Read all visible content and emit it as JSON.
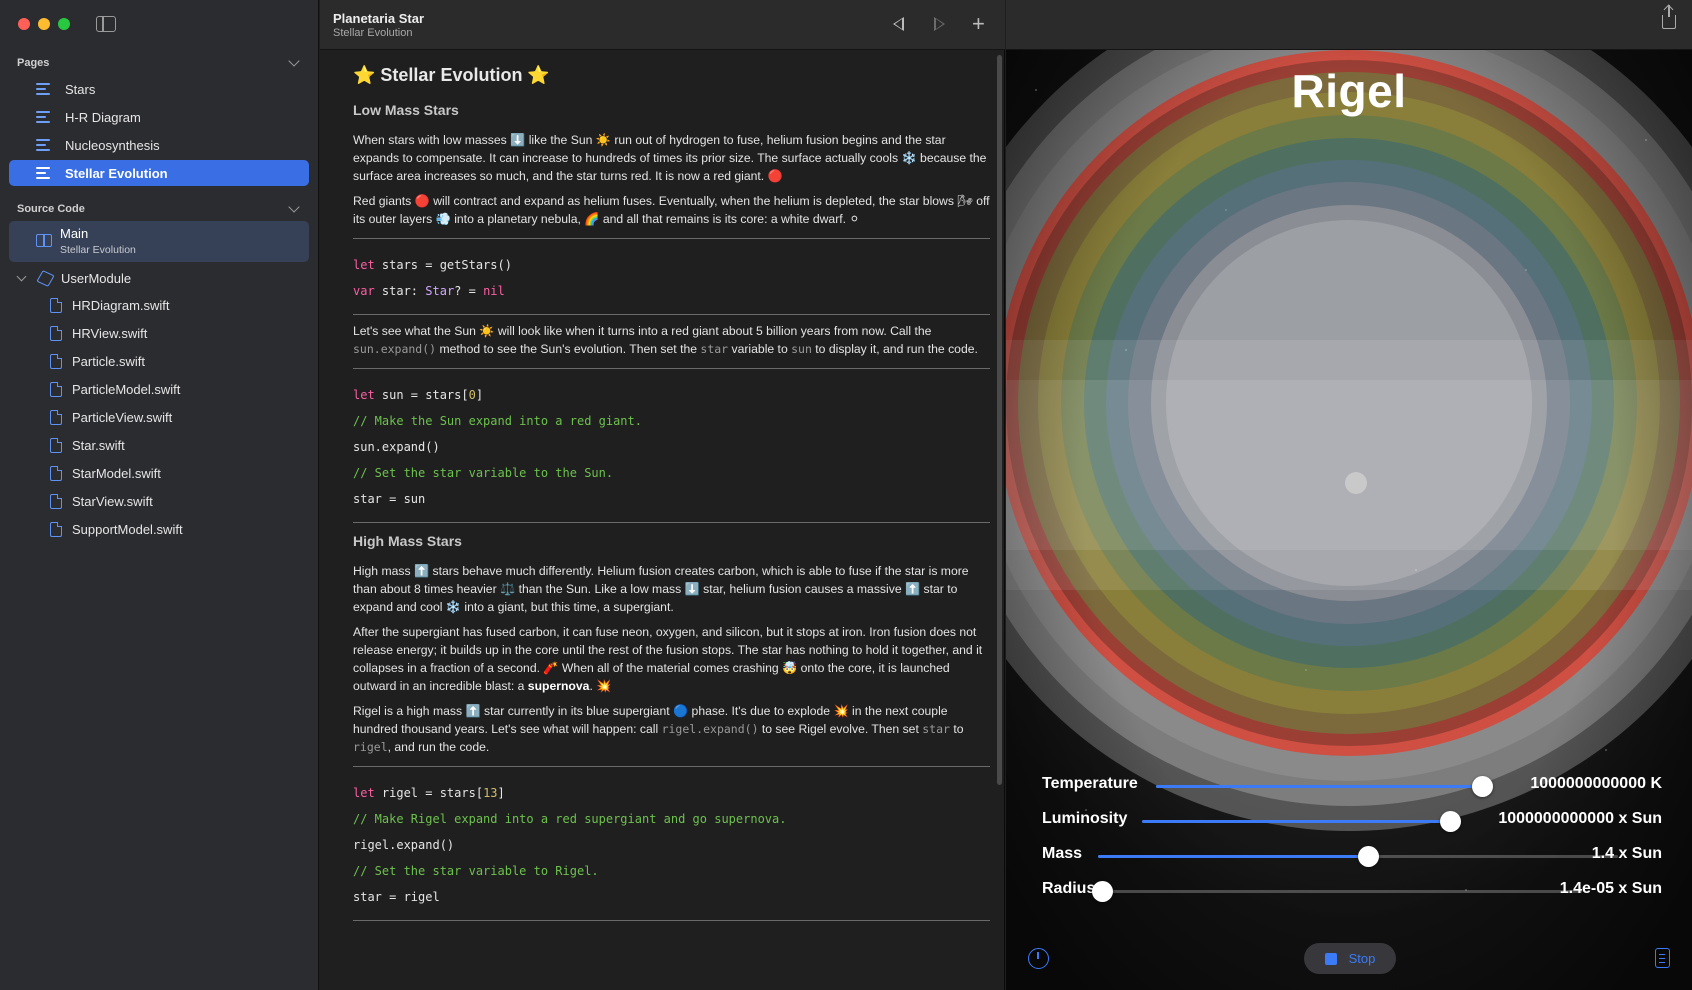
{
  "sidebar": {
    "pages_header": "Pages",
    "pages": [
      {
        "label": "Stars",
        "active": false
      },
      {
        "label": "H-R Diagram",
        "active": false
      },
      {
        "label": "Nucleosynthesis",
        "active": false
      },
      {
        "label": "Stellar Evolution",
        "active": true
      }
    ],
    "source_header": "Source Code",
    "main_item": {
      "title": "Main",
      "subtitle": "Stellar Evolution"
    },
    "module": "UserModule",
    "files": [
      "HRDiagram.swift",
      "HRView.swift",
      "Particle.swift",
      "ParticleModel.swift",
      "ParticleView.swift",
      "Star.swift",
      "StarModel.swift",
      "StarView.swift",
      "SupportModel.swift"
    ]
  },
  "editor": {
    "title": "Planetaria Star",
    "subtitle": "Stellar Evolution",
    "heading": "⭐ Stellar Evolution ⭐",
    "low_mass_title": "Low Mass Stars",
    "low_mass_p1": "When stars with low masses ⬇️ like the Sun ☀️ run out of hydrogen to fuse, helium fusion begins and the star expands to compensate. It can increase to hundreds of times its prior size. The surface actually cools ❄️ because the surface area increases so much, and the star turns red. It is now a red giant. 🔴",
    "low_mass_p2": "Red giants 🔴 will contract and expand as helium fuses. Eventually, when the helium is depleted, the star blows 🌬 off its outer layers 💨 into a planetary nebula, 🌈 and all that remains is its core: a white dwarf. ⚪",
    "sun_p_before_1": "Let's see what the Sun ☀️ will look like when it turns into a red giant about 5 billion years from now. Call the ",
    "sun_code_1": "sun.expand()",
    "sun_p_mid_1": " method to see the Sun's evolution. Then set the ",
    "sun_code_2": "star",
    "sun_p_mid_2": " variable to ",
    "sun_code_3": "sun",
    "sun_p_after": " to display it, and run the code.",
    "high_mass_title": "High Mass Stars",
    "high_mass_p1": "High mass ⬆️ stars behave much differently. Helium fusion creates carbon, which is able to fuse if the star is more than about 8 times heavier ⚖️ than the Sun. Like a low mass ⬇️ star, helium fusion causes a massive ⬆️ star to expand and cool ❄️ into a giant, but this time, a supergiant.",
    "high_mass_p2_before": "After the supergiant has fused carbon, it can fuse neon, oxygen, and silicon, but it stops at iron. Iron fusion does not release energy; it builds up in the core until the rest of the fusion stops. The star has nothing to hold it together, and it collapses in a fraction of a second. 🧨 When all of the material comes crashing 🤯 onto the core, it is launched outward in an incredible blast: a ",
    "high_mass_p2_bold": "supernova",
    "high_mass_p2_after": ". 💥",
    "rigel_p_before": "Rigel is a high mass ⬆️ star currently in its blue supergiant 🔵 phase. It's due to explode 💥 in the next couple hundred thousand years. Let's see what will happen: call ",
    "rigel_code_1": "rigel.expand()",
    "rigel_p_mid": " to see Rigel evolve. Then set ",
    "rigel_code_2": "star",
    "rigel_p_mid2": " to ",
    "rigel_code_3": "rigel",
    "rigel_p_after": ", and run the code.",
    "code1": {
      "l1_kw": "let",
      "l1_rest": " stars = getStars()",
      "l2_kw": "var",
      "l2_a": " star: ",
      "l2_type": "Star",
      "l2_b": "? = ",
      "l2_nil": "nil"
    },
    "code2": {
      "l1_kw": "let",
      "l1_a": " sun = stars[",
      "l1_num": "0",
      "l1_b": "]",
      "l2": "// Make the Sun expand into a red giant.",
      "l3": "sun.expand()",
      "l4": "// Set the star variable to the Sun.",
      "l5": "star = sun"
    },
    "code3": {
      "l1_kw": "let",
      "l1_a": " rigel = stars[",
      "l1_num": "13",
      "l1_b": "]",
      "l2": "// Make Rigel expand into a red supergiant and go supernova.",
      "l3": "rigel.expand()",
      "l4": "// Set the star variable to Rigel.",
      "l5": "star = rigel"
    }
  },
  "preview": {
    "star_name": "Rigel",
    "controls": [
      {
        "label": "Temperature",
        "value": "1000000000000 K",
        "fraction": 0.97
      },
      {
        "label": "Luminosity",
        "value": "1000000000000 x Sun",
        "fraction": 0.97
      },
      {
        "label": "Mass",
        "value": "1.4 x Sun",
        "fraction": 0.52
      },
      {
        "label": "Radius",
        "value": "1.4e-05 x Sun",
        "fraction": 0.0
      }
    ],
    "stop_label": "Stop",
    "accent": "#3b7bf7"
  }
}
